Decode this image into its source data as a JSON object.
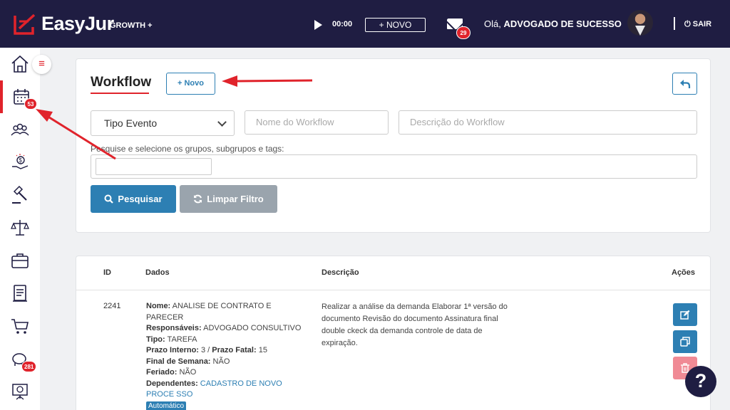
{
  "header": {
    "brand": "EasyJur",
    "plan": "GROWTH +",
    "timer": "00:00",
    "new_label": "+ NOVO",
    "mail_count": "29",
    "greeting_prefix": "Olá, ",
    "user_name": "ADVOGADO DE SUCESSO",
    "logout_label": "SAIR"
  },
  "sidebar": {
    "items": [
      {
        "icon": "home-icon"
      },
      {
        "icon": "calendar-icon",
        "badge": "53"
      },
      {
        "icon": "people-icon"
      },
      {
        "icon": "finance-hand-icon"
      },
      {
        "icon": "gavel-icon"
      },
      {
        "icon": "scales-icon"
      },
      {
        "icon": "briefcase-icon"
      },
      {
        "icon": "document-icon"
      },
      {
        "icon": "cart-icon"
      },
      {
        "icon": "piggy-bank-icon",
        "badge": "281"
      },
      {
        "icon": "presentation-icon"
      }
    ],
    "menu_toggle": "≡"
  },
  "filter": {
    "title": "Workflow",
    "new_button": "+ Novo",
    "select_value": "Tipo Evento",
    "name_placeholder": "Nome do Workflow",
    "desc_placeholder": "Descrição do Workflow",
    "tags_label": "Pesquise e selecione os grupos, subgrupos e tags:",
    "search_button": "Pesquisar",
    "clear_button": "Limpar Filtro"
  },
  "table": {
    "headers": {
      "id": "ID",
      "dados": "Dados",
      "descricao": "Descrição",
      "acoes": "Ações"
    },
    "rows": [
      {
        "id": "2241",
        "nome_label": "Nome:",
        "nome": " ANALISE DE CONTRATO E PARECER",
        "resp_label": "Responsáveis:",
        "resp": " ADVOGADO CONSULTIVO",
        "tipo_label": "Tipo:",
        "tipo": " TAREFA",
        "prazo_int_label": "Prazo Interno:",
        "prazo_int": " 3 / ",
        "prazo_fatal_label": "Prazo Fatal:",
        "prazo_fatal": " 15",
        "fim_semana_label": "Final de Semana:",
        "fim_semana": " NÃO",
        "feriado_label": "Feriado:",
        "feriado": " NÃO",
        "dependentes_label": "Dependentes:",
        "dependentes": " CADASTRO DE NOVO PROCE SSO",
        "badge": "Automático",
        "descricao": "Realizar a análise da demanda Elaborar 1ª versão do documento Revisão do documento Assinatura final double ckeck da demanda controle de data de expiração."
      }
    ]
  },
  "help_label": "?",
  "colors": {
    "brand": "#1f1d42",
    "accent": "#e0232b",
    "primary": "#2d7fb3"
  }
}
